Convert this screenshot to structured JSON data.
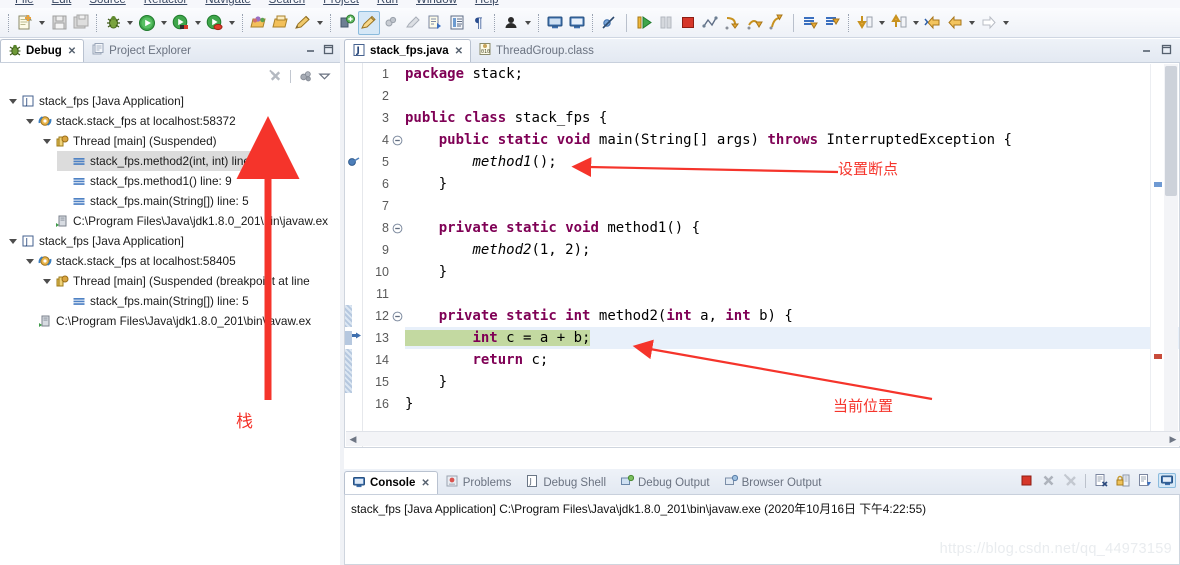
{
  "menubar": {
    "items": [
      "File",
      "Edit",
      "Source",
      "Refactor",
      "Navigate",
      "Search",
      "Project",
      "Run",
      "Window",
      "Help"
    ]
  },
  "toolbar": {
    "icons": [
      "new-file-icon",
      "new-file-dropdown",
      "save-icon",
      "save-all-icon",
      "debug-icon",
      "debug-dropdown",
      "run-icon",
      "run-dropdown",
      "run-coverage-icon",
      "run-coverage-dropdown",
      "run-error-icon",
      "run-error-dropdown",
      "open-type-icon",
      "open-task-icon",
      "pencil-icon",
      "pencil-dropdown",
      "new-java-project-icon",
      "highlight-icon",
      "toggle-marks-icon",
      "eraser-icon",
      "external-tools-icon",
      "table-icon",
      "paragraph-icon",
      "person-icon",
      "person-dropdown",
      "console-icon",
      "display-icon",
      "skip-breakpoints-icon",
      "resume-icon",
      "suspend-icon",
      "terminate-icon",
      "disconnect-icon",
      "step-into-icon",
      "step-over-icon",
      "step-return-icon",
      "next-annotation-icon",
      "previous-annotation-icon",
      "next-edit-icon",
      "next-edit-dropdown",
      "previous-edit-icon",
      "previous-edit-dropdown",
      "back-to-icon",
      "back-icon",
      "back-dropdown",
      "forward-icon",
      "forward-dropdown"
    ]
  },
  "debug_view": {
    "tabs": [
      {
        "label": "Debug",
        "icon": "bug-icon",
        "active": true,
        "closable": true
      },
      {
        "label": "Project Explorer",
        "icon": "project-explorer-icon",
        "active": false,
        "closable": false
      }
    ],
    "view_buttons": [
      "minimize-icon",
      "maximize-icon"
    ],
    "toolbar_buttons": [
      "remove-all-terminated-icon",
      "thread-group-icon",
      "view-menu-icon"
    ],
    "tree": [
      {
        "indent": 0,
        "twisty": "open",
        "icon": "java-application-icon",
        "label": "stack_fps [Java Application]",
        "selected": false
      },
      {
        "indent": 1,
        "twisty": "open",
        "icon": "debug-target-icon",
        "label": "stack.stack_fps at localhost:58372",
        "selected": false
      },
      {
        "indent": 2,
        "twisty": "open",
        "icon": "thread-icon",
        "label": "Thread [main] (Suspended)",
        "selected": false
      },
      {
        "indent": 3,
        "twisty": "none",
        "icon": "stack-frame-icon",
        "label": "stack_fps.method2(int, int) line: 13",
        "selected": true
      },
      {
        "indent": 3,
        "twisty": "none",
        "icon": "stack-frame-icon",
        "label": "stack_fps.method1() line: 9",
        "selected": false
      },
      {
        "indent": 3,
        "twisty": "none",
        "icon": "stack-frame-icon",
        "label": "stack_fps.main(String[]) line: 5",
        "selected": false
      },
      {
        "indent": 2,
        "twisty": "none",
        "icon": "process-icon",
        "label": "C:\\Program Files\\Java\\jdk1.8.0_201\\bin\\javaw.ex",
        "selected": false
      },
      {
        "indent": 0,
        "twisty": "open",
        "icon": "java-application-icon",
        "label": "stack_fps [Java Application]",
        "selected": false
      },
      {
        "indent": 1,
        "twisty": "open",
        "icon": "debug-target-icon",
        "label": "stack.stack_fps at localhost:58405",
        "selected": false
      },
      {
        "indent": 2,
        "twisty": "open",
        "icon": "thread-icon",
        "label": "Thread [main] (Suspended (breakpoint at line",
        "selected": false
      },
      {
        "indent": 3,
        "twisty": "none",
        "icon": "stack-frame-icon",
        "label": "stack_fps.main(String[]) line: 5",
        "selected": false
      },
      {
        "indent": 1,
        "twisty": "none",
        "icon": "process-icon",
        "label": "C:\\Program Files\\Java\\jdk1.8.0_201\\bin\\javaw.ex",
        "selected": false
      }
    ]
  },
  "editor": {
    "tabs": [
      {
        "label": "stack_fps.java",
        "icon": "java-file-icon",
        "active": true,
        "closable": true
      },
      {
        "label": "ThreadGroup.class",
        "icon": "class-file-icon",
        "active": false,
        "closable": false
      }
    ],
    "view_buttons": [
      "minimize-icon",
      "maximize-icon"
    ],
    "lines": [
      {
        "num": "1",
        "fold": "none",
        "bp": "none",
        "hl": "none",
        "text": "package stack;"
      },
      {
        "num": "2",
        "fold": "none",
        "bp": "none",
        "hl": "none",
        "text": ""
      },
      {
        "num": "3",
        "fold": "none",
        "bp": "none",
        "hl": "none",
        "text": "public class stack_fps {"
      },
      {
        "num": "4",
        "fold": "collapse",
        "bp": "none",
        "hl": "none",
        "text": "    public static void main(String[] args) throws InterruptedException {"
      },
      {
        "num": "5",
        "fold": "none",
        "bp": "breakpoint",
        "hl": "none",
        "text": "        method1();"
      },
      {
        "num": "6",
        "fold": "none",
        "bp": "none",
        "hl": "none",
        "text": "    }"
      },
      {
        "num": "7",
        "fold": "none",
        "bp": "none",
        "hl": "none",
        "text": ""
      },
      {
        "num": "8",
        "fold": "collapse",
        "bp": "none",
        "hl": "none",
        "text": "    private static void method1() {"
      },
      {
        "num": "9",
        "fold": "none",
        "bp": "none",
        "hl": "none",
        "text": "        method2(1, 2);"
      },
      {
        "num": "10",
        "fold": "none",
        "bp": "none",
        "hl": "none",
        "text": "    }"
      },
      {
        "num": "11",
        "fold": "none",
        "bp": "none",
        "hl": "none",
        "text": ""
      },
      {
        "num": "12",
        "fold": "collapse",
        "bp": "range",
        "hl": "none",
        "text": "    private static int method2(int a, int b) {"
      },
      {
        "num": "13",
        "fold": "none",
        "bp": "current",
        "hl": "exec",
        "text": "        int c = a + b;"
      },
      {
        "num": "14",
        "fold": "none",
        "bp": "range",
        "hl": "none",
        "text": "        return c;"
      },
      {
        "num": "15",
        "fold": "none",
        "bp": "range",
        "hl": "none",
        "text": "    }"
      },
      {
        "num": "16",
        "fold": "none",
        "bp": "none",
        "hl": "none",
        "text": "}"
      }
    ]
  },
  "console": {
    "tabs": [
      {
        "label": "Console",
        "icon": "console-icon",
        "active": true,
        "closable": true
      },
      {
        "label": "Problems",
        "icon": "problems-icon",
        "active": false,
        "closable": false
      },
      {
        "label": "Debug Shell",
        "icon": "debug-shell-icon",
        "active": false,
        "closable": false
      },
      {
        "label": "Debug Output",
        "icon": "debug-output-icon",
        "active": false,
        "closable": false
      },
      {
        "label": "Browser Output",
        "icon": "browser-output-icon",
        "active": false,
        "closable": false
      }
    ],
    "toolbar_buttons": [
      "terminate-icon",
      "remove-launch-icon",
      "remove-all-launches-icon",
      "clear-console-icon",
      "scroll-lock-icon",
      "pin-console-icon",
      "display-console-icon"
    ],
    "output": "stack_fps [Java Application] C:\\Program Files\\Java\\jdk1.8.0_201\\bin\\javaw.exe (2020年10月16日 下午4:22:55)"
  },
  "annotations": {
    "set_breakpoint": "设置断点",
    "current_position": "当前位置",
    "stack": "栈",
    "color": "#f5342b"
  },
  "watermark": "https://blog.csdn.net/qq_44973159"
}
